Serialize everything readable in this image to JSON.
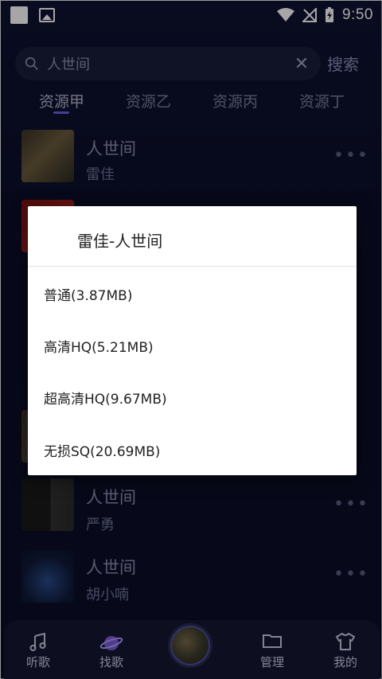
{
  "status_bar": {
    "time": "9:50"
  },
  "search": {
    "value": "人世间",
    "button_label": "搜索"
  },
  "tabs": [
    "资源甲",
    "资源乙",
    "资源丙",
    "资源丁"
  ],
  "list": [
    {
      "title": "人世间",
      "artist": "雷佳",
      "more": "•••"
    },
    {
      "title": "人世间",
      "artist": "严勇",
      "more": "•••"
    },
    {
      "title": "人世间",
      "artist": "胡小喃",
      "more": "•••"
    }
  ],
  "dialog": {
    "title": "雷佳-人世间",
    "options": [
      "普通(3.87MB)",
      "高清HQ(5.21MB)",
      "超高清HQ(9.67MB)",
      "无损SQ(20.69MB)"
    ]
  },
  "bottom_nav": [
    {
      "label": "听歌",
      "icon": "music-note-icon"
    },
    {
      "label": "找歌",
      "icon": "planet-icon"
    },
    {
      "label": "管理",
      "icon": "folder-icon"
    },
    {
      "label": "我的",
      "icon": "shirt-icon"
    }
  ],
  "colors": {
    "accent": "#6a5fe0",
    "background": "#0d0f2a",
    "dialog_bg": "#ffffff"
  }
}
